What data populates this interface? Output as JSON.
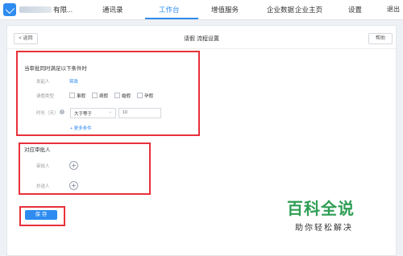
{
  "topbar": {
    "company_name": "有限...",
    "nav": [
      "通讯录",
      "工作台",
      "增值服务",
      "企业数据",
      "企业主页",
      "设置"
    ],
    "active_nav": "工作台",
    "logout": "退出"
  },
  "header": {
    "back_label": "< 返回",
    "title": "请假 流程设置",
    "help_label": "帮助"
  },
  "conditions": {
    "heading": "当审批同时满足以下条件时",
    "initiator_label": "发起人",
    "initiator_value": "蒋政",
    "leave_type_label": "请假类型",
    "leave_types": [
      "事假",
      "病假",
      "婚假",
      "孕假"
    ],
    "duration_label": "时长（天）",
    "operator": "大于等于",
    "duration_value": "10",
    "add_condition": "+ 更多条件"
  },
  "approvers": {
    "heading": "对应审批人",
    "approver_label": "审批人",
    "cc_label": "抄送人"
  },
  "save_label": "保 存",
  "watermark": {
    "main": "百科全说",
    "sub": "助你轻松解决"
  },
  "colors": {
    "accent": "#2e8cf0",
    "highlight_box": "#e8313b",
    "watermark": "#2f9e55"
  }
}
